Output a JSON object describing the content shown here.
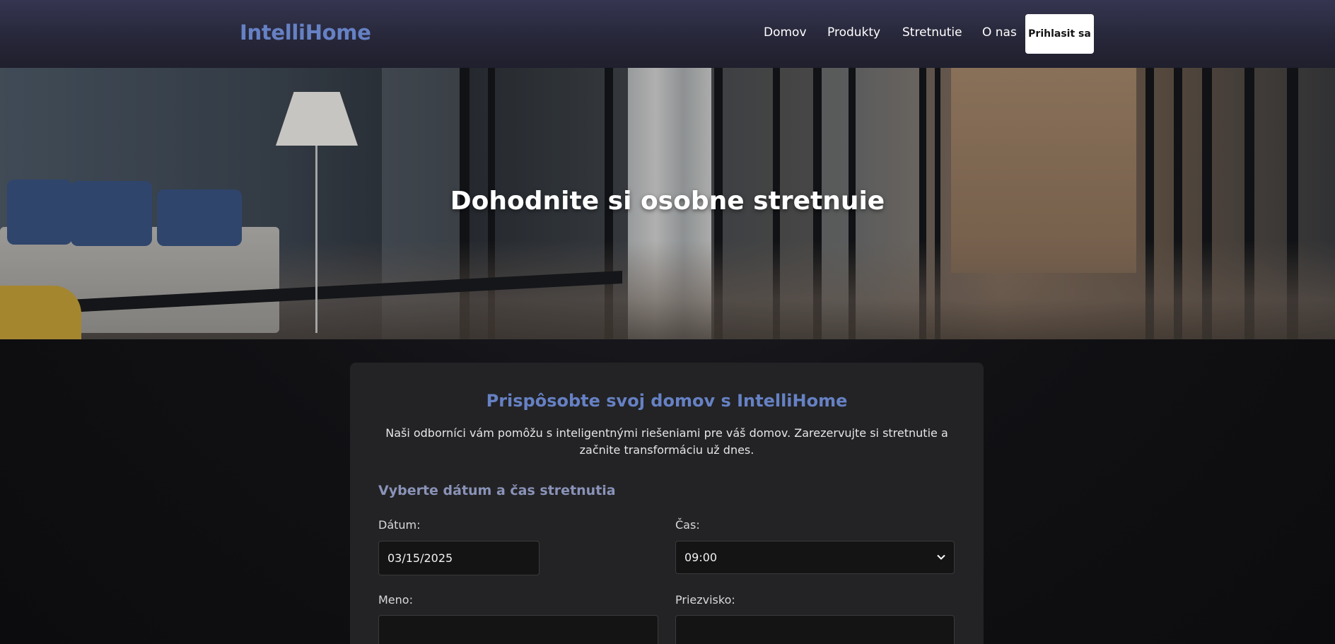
{
  "header": {
    "brand": "IntelliHome",
    "nav": [
      "Domov",
      "Produkty",
      "Stretnutie",
      "O nas"
    ],
    "login_label": "Prihlasit sa"
  },
  "hero": {
    "title": "Dohodnite si osobne stretnuie"
  },
  "card": {
    "title": "Prispôsobte svoj domov s IntelliHome",
    "description": "Naši odborníci vám pomôžu s inteligentnými riešeniami pre váš domov. Zarezervujte si stretnutie a začnite transformáciu už dnes.",
    "section_title": "Vyberte dátum a čas stretnutia",
    "fields": {
      "date_label": "Dátum:",
      "date_value": "03/15/2025",
      "time_label": "Čas:",
      "time_value": "09:00",
      "first_name_label": "Meno:",
      "first_name_value": "",
      "last_name_label": "Priezvisko:",
      "last_name_value": ""
    }
  },
  "colors": {
    "accent": "#6681c4",
    "section_accent": "#8a93b8",
    "header_bg": "#2a2a3e",
    "card_bg": "#232325"
  },
  "icons": {
    "select_chevron": "chevron-down-icon"
  }
}
